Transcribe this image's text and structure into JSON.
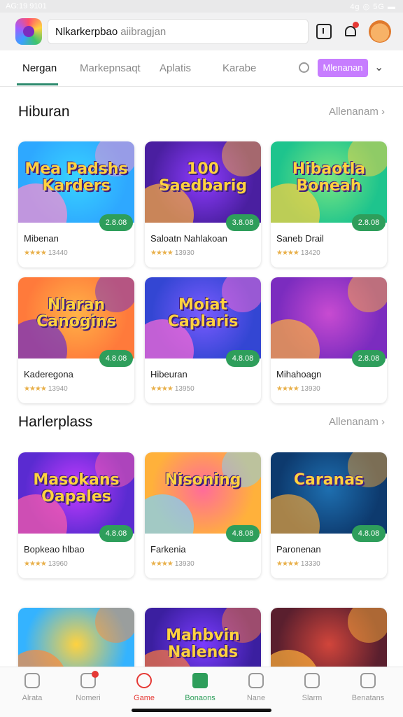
{
  "status": {
    "time": "AG:19 9101",
    "right": "4g ◎ 5G ▬"
  },
  "header": {
    "search_value": "Nlkarkerpbao",
    "search_placeholder": "aiibragjan"
  },
  "tabs": [
    {
      "label": "Nergan",
      "active": true
    },
    {
      "label": "Markepnsaqt",
      "active": false
    },
    {
      "label": "Aplatis",
      "active": false
    },
    {
      "label": "Karabe",
      "active": false
    }
  ],
  "tabs_pill": "Mlenanan",
  "sections": [
    {
      "title": "Hiburan",
      "more": "Allenanam ›",
      "cards": [
        {
          "art_text": "Mea Padshs Karders",
          "title": "Mibenan",
          "price": "2.8.08",
          "rating": "13440",
          "colors": [
            "#2ea8ff",
            "#38d3ff",
            "#ff8fd0"
          ]
        },
        {
          "art_text": "100 Saedbarig",
          "title": "Saloatn Nahlakoan",
          "price": "3.8.08",
          "rating": "13930",
          "colors": [
            "#4a1fa0",
            "#8e3bff",
            "#ffb13b"
          ]
        },
        {
          "art_text": "Hibaotla Boneah",
          "title": "Saneb Drail",
          "price": "2.8.08",
          "rating": "13420",
          "colors": [
            "#1ec48d",
            "#7ae582",
            "#ffd23f"
          ]
        }
      ]
    },
    {
      "title": "",
      "more": "",
      "cards": [
        {
          "art_text": "Nlaran Canogins",
          "title": "Kaderegona",
          "price": "4.8.08",
          "rating": "13940",
          "colors": [
            "#ff7a3b",
            "#ffb347",
            "#6b2fc9"
          ]
        },
        {
          "art_text": "Moiat Caplaris",
          "title": "Hibeuran",
          "price": "4.8.08",
          "rating": "13950",
          "colors": [
            "#3346d3",
            "#7a5bff",
            "#ff6bd6"
          ]
        },
        {
          "art_text": "",
          "title": "Mihahoagn",
          "price": "2.8.08",
          "rating": "13930",
          "colors": [
            "#7b2cbf",
            "#c84bd1",
            "#ffb13b"
          ]
        }
      ]
    },
    {
      "title": "Harlerplass",
      "more": "Allenanam ›",
      "cards": [
        {
          "art_text": "Masokans Oapales",
          "title": "Bopkeao hlbao",
          "price": "4.8.08",
          "rating": "13960",
          "colors": [
            "#5a2bd1",
            "#c23bff",
            "#ff5ea8"
          ]
        },
        {
          "art_text": "Nisoning",
          "title": "Farkenia",
          "price": "4.8.08",
          "rating": "13930",
          "colors": [
            "#ffb13b",
            "#ff6b9a",
            "#7ad3ff"
          ]
        },
        {
          "art_text": "Caranas",
          "title": "Paronenan",
          "price": "4.8.08",
          "rating": "13330",
          "colors": [
            "#0d3a6e",
            "#1e6fb0",
            "#e9a23b"
          ]
        }
      ]
    },
    {
      "title": "",
      "more": "",
      "cards": [
        {
          "art_text": "",
          "title": "",
          "price": "",
          "rating": "",
          "colors": [
            "#34b3ff",
            "#ffd23f",
            "#ff8a3b"
          ]
        },
        {
          "art_text": "Mahbvin Nalends",
          "title": "",
          "price": "",
          "rating": "",
          "colors": [
            "#3b1fa0",
            "#7b3bff",
            "#ff7a3b"
          ]
        },
        {
          "art_text": "",
          "title": "",
          "price": "",
          "rating": "",
          "colors": [
            "#5a1f2e",
            "#d1453b",
            "#ffb13b"
          ]
        }
      ]
    }
  ],
  "bottom_nav": [
    {
      "label": "Alrata",
      "icon": "home-icon",
      "state": "normal"
    },
    {
      "label": "Nomeri",
      "icon": "notes-icon",
      "state": "badge"
    },
    {
      "label": "Game",
      "icon": "search-icon",
      "state": "active"
    },
    {
      "label": "Bonaons",
      "icon": "bonus-icon",
      "state": "green"
    },
    {
      "label": "Nane",
      "icon": "chat-icon",
      "state": "normal"
    },
    {
      "label": "Slarm",
      "icon": "explore-icon",
      "state": "normal"
    },
    {
      "label": "Benatans",
      "icon": "profile-icon",
      "state": "normal"
    }
  ]
}
